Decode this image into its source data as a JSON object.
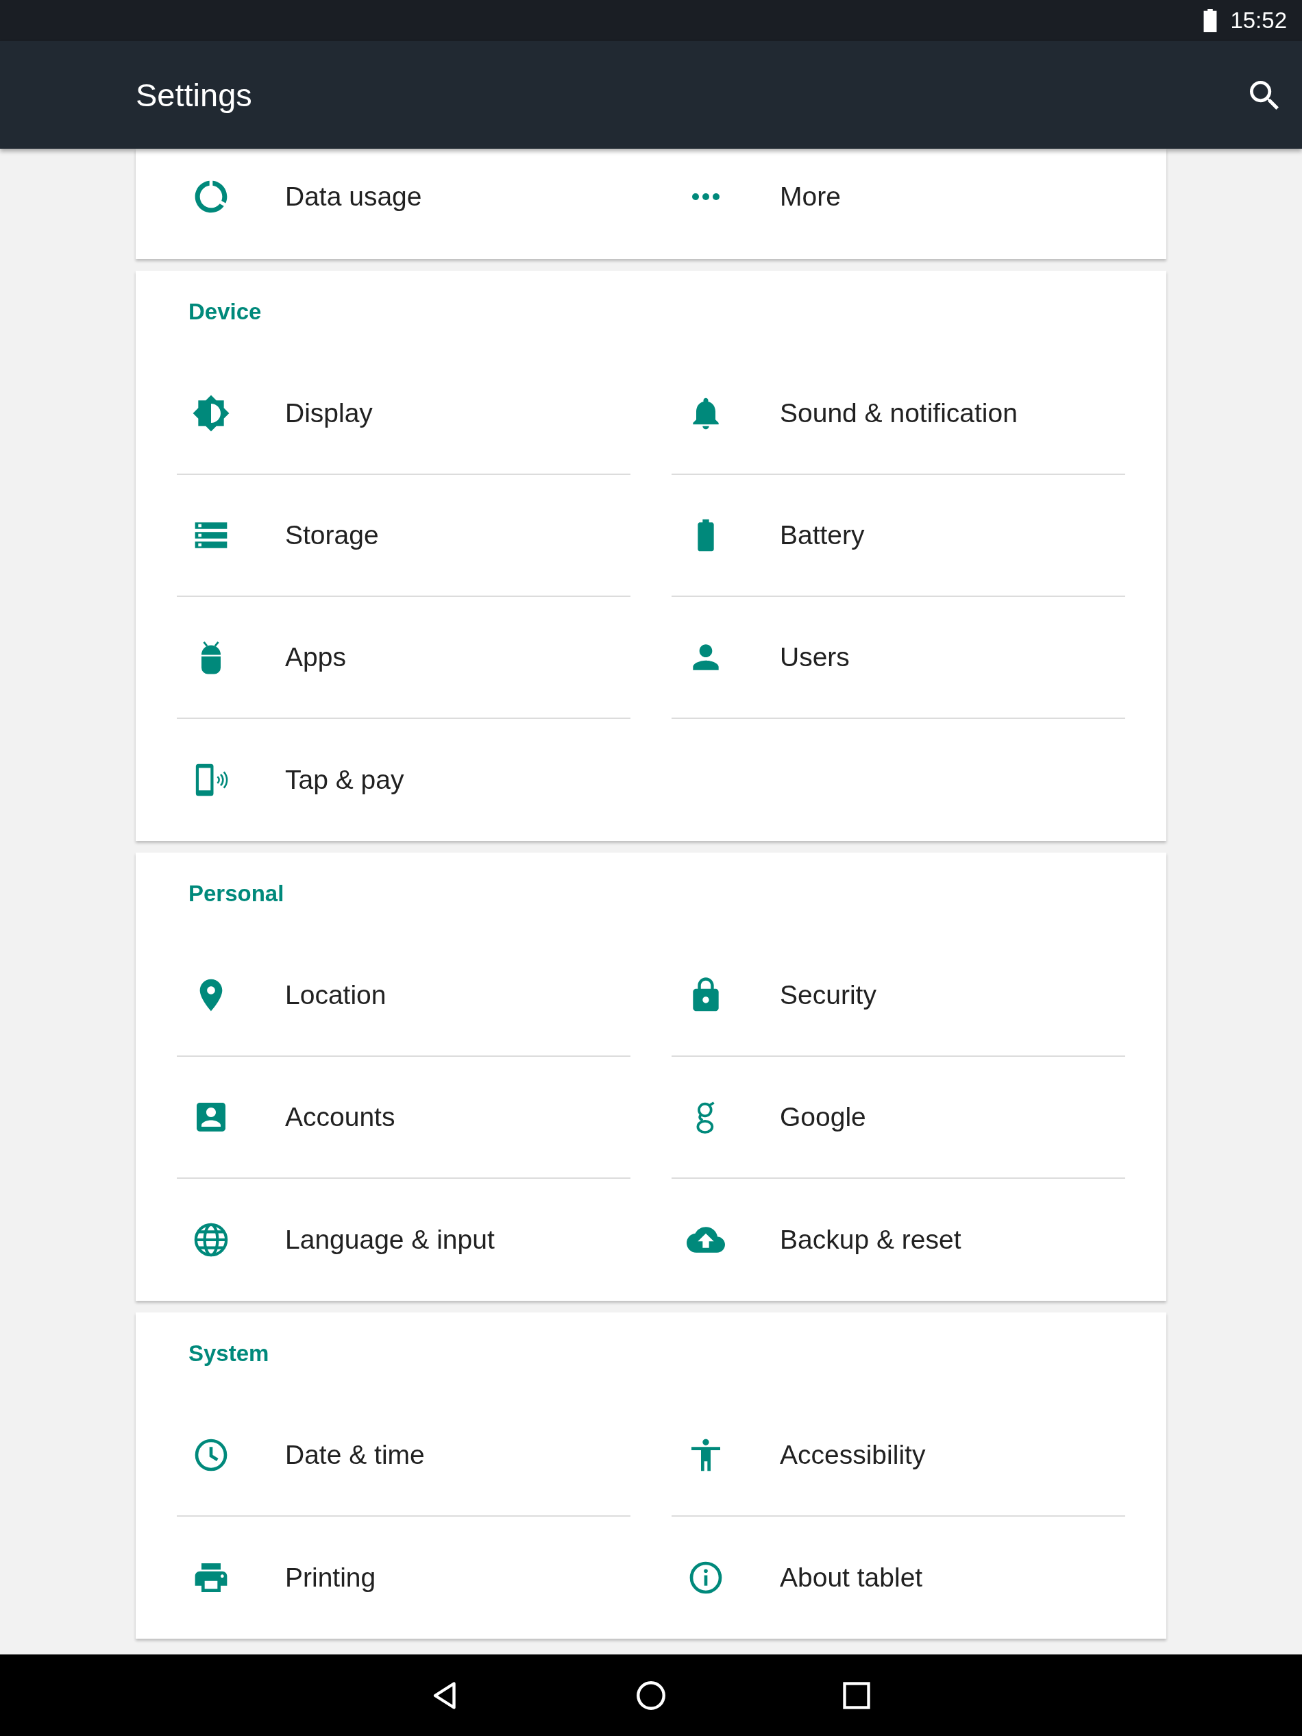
{
  "status_bar": {
    "time": "15:52"
  },
  "toolbar": {
    "title": "Settings"
  },
  "sections": [
    {
      "items": [
        {
          "label": "Data usage"
        },
        {
          "label": "More"
        }
      ]
    },
    {
      "header": "Device",
      "items": [
        {
          "label": "Display"
        },
        {
          "label": "Sound & notification"
        },
        {
          "label": "Storage"
        },
        {
          "label": "Battery"
        },
        {
          "label": "Apps"
        },
        {
          "label": "Users"
        },
        {
          "label": "Tap & pay"
        }
      ]
    },
    {
      "header": "Personal",
      "items": [
        {
          "label": "Location"
        },
        {
          "label": "Security"
        },
        {
          "label": "Accounts"
        },
        {
          "label": "Google"
        },
        {
          "label": "Language & input"
        },
        {
          "label": "Backup & reset"
        }
      ]
    },
    {
      "header": "System",
      "items": [
        {
          "label": "Date & time"
        },
        {
          "label": "Accessibility"
        },
        {
          "label": "Printing"
        },
        {
          "label": "About tablet"
        }
      ]
    }
  ]
}
